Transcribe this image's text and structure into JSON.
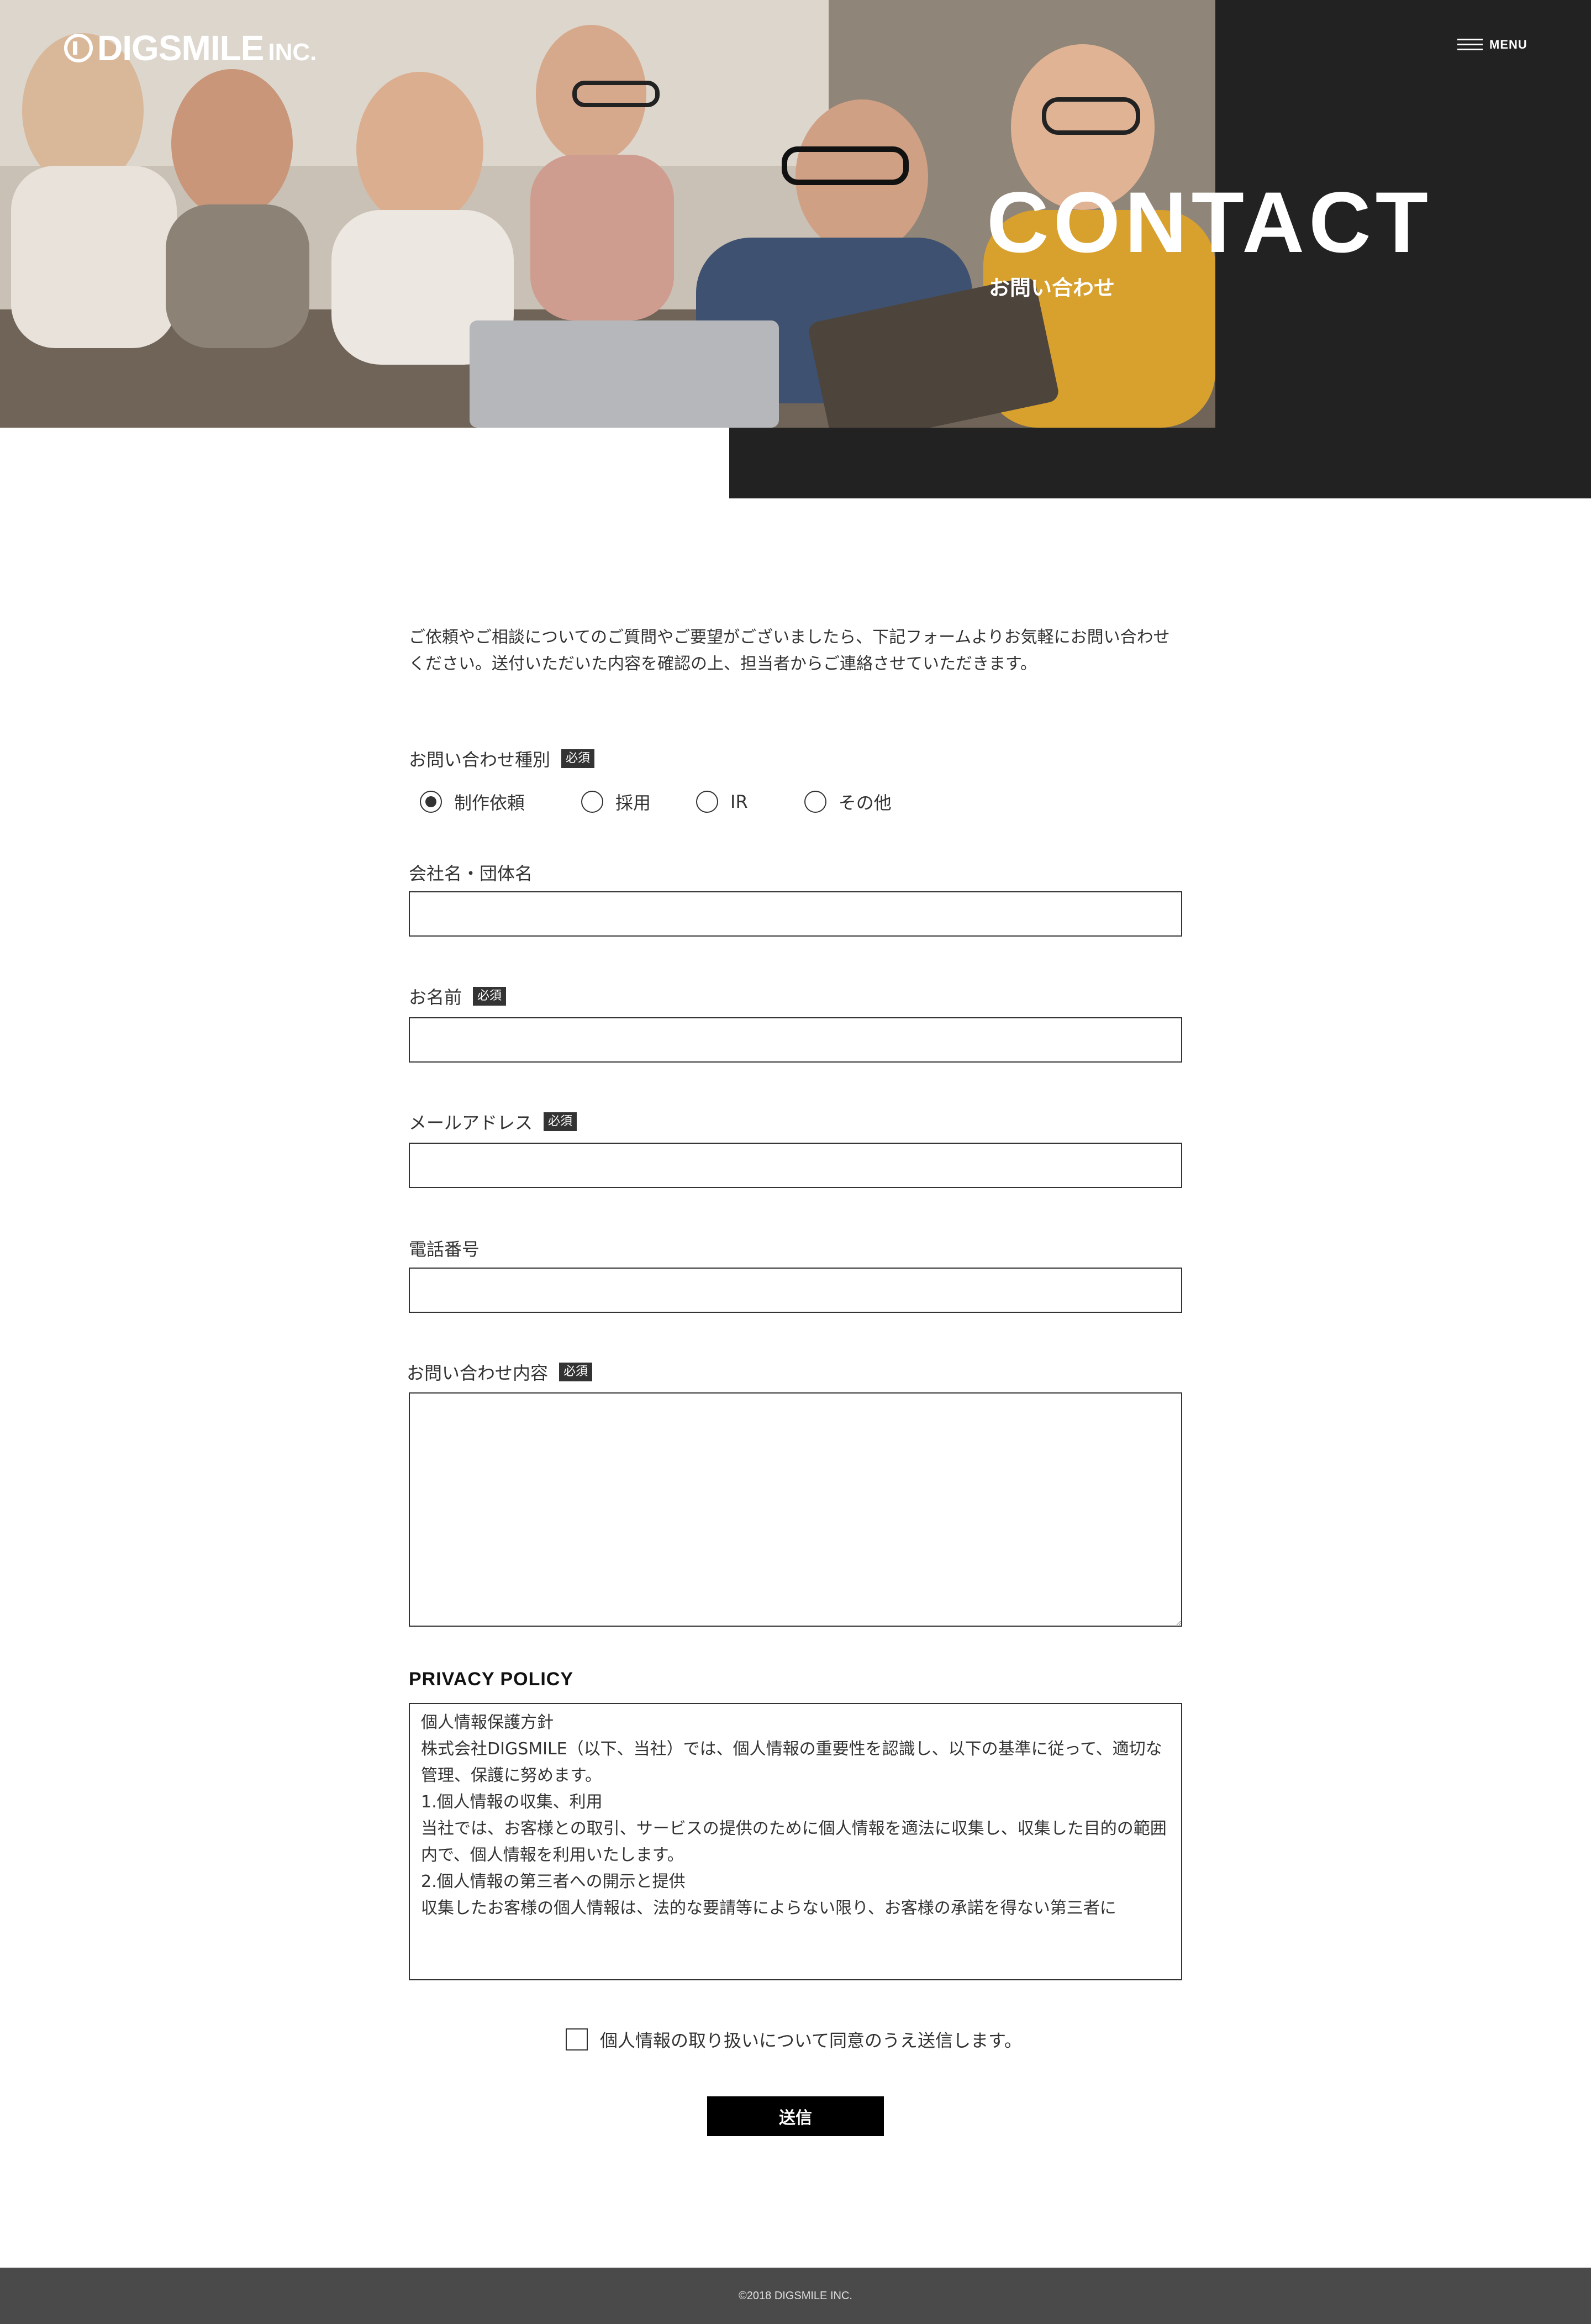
{
  "header": {
    "logo_text": "DIGSMILE",
    "logo_suffix": "INC.",
    "menu_label": "MENU"
  },
  "hero": {
    "title": "CONTACT",
    "subtitle": "お問い合わせ"
  },
  "intro": "ご依頼やご相談についてのご質問やご要望がございましたら、下記フォームよりお気軽にお問い合わせください。送付いただいた内容を確認の上、担当者からご連絡させていただきます。",
  "required_badge": "必須",
  "form": {
    "inquiry_type": {
      "label": "お問い合わせ種別",
      "options": [
        "制作依頼",
        "採用",
        "IR",
        "その他"
      ],
      "selected": "制作依頼"
    },
    "company": {
      "label": "会社名・団体名",
      "value": ""
    },
    "name": {
      "label": "お名前",
      "value": ""
    },
    "email": {
      "label": "メールアドレス",
      "value": ""
    },
    "phone": {
      "label": "電話番号",
      "value": ""
    },
    "message": {
      "label": "お問い合わせ内容",
      "value": ""
    }
  },
  "privacy": {
    "title": "PRIVACY POLICY",
    "lines": [
      "個人情報保護方針",
      "株式会社DIGSMILE（以下、当社）では、個人情報の重要性を認識し、以下の基準に従って、適切な管理、保護に努めます。",
      "",
      "1.個人情報の収集、利用",
      "当社では、お客様との取引、サービスの提供のために個人情報を適法に収集し、収集した目的の範囲内で、個人情報を利用いたします。",
      "",
      "2.個人情報の第三者への開示と提供",
      "収集したお客様の個人情報は、法的な要請等によらない限り、お客様の承諾を得ない第三者に"
    ]
  },
  "agree_label": "個人情報の取り扱いについて同意のうえ送信します。",
  "agree_checked": false,
  "submit_label": "送信",
  "footer": {
    "copyright": "©2018 DIGSMILE INC."
  },
  "colors": {
    "dark_panel": "#222222",
    "text": "#333333",
    "footer_bg": "#4a4a4a",
    "button_bg": "#000000"
  }
}
